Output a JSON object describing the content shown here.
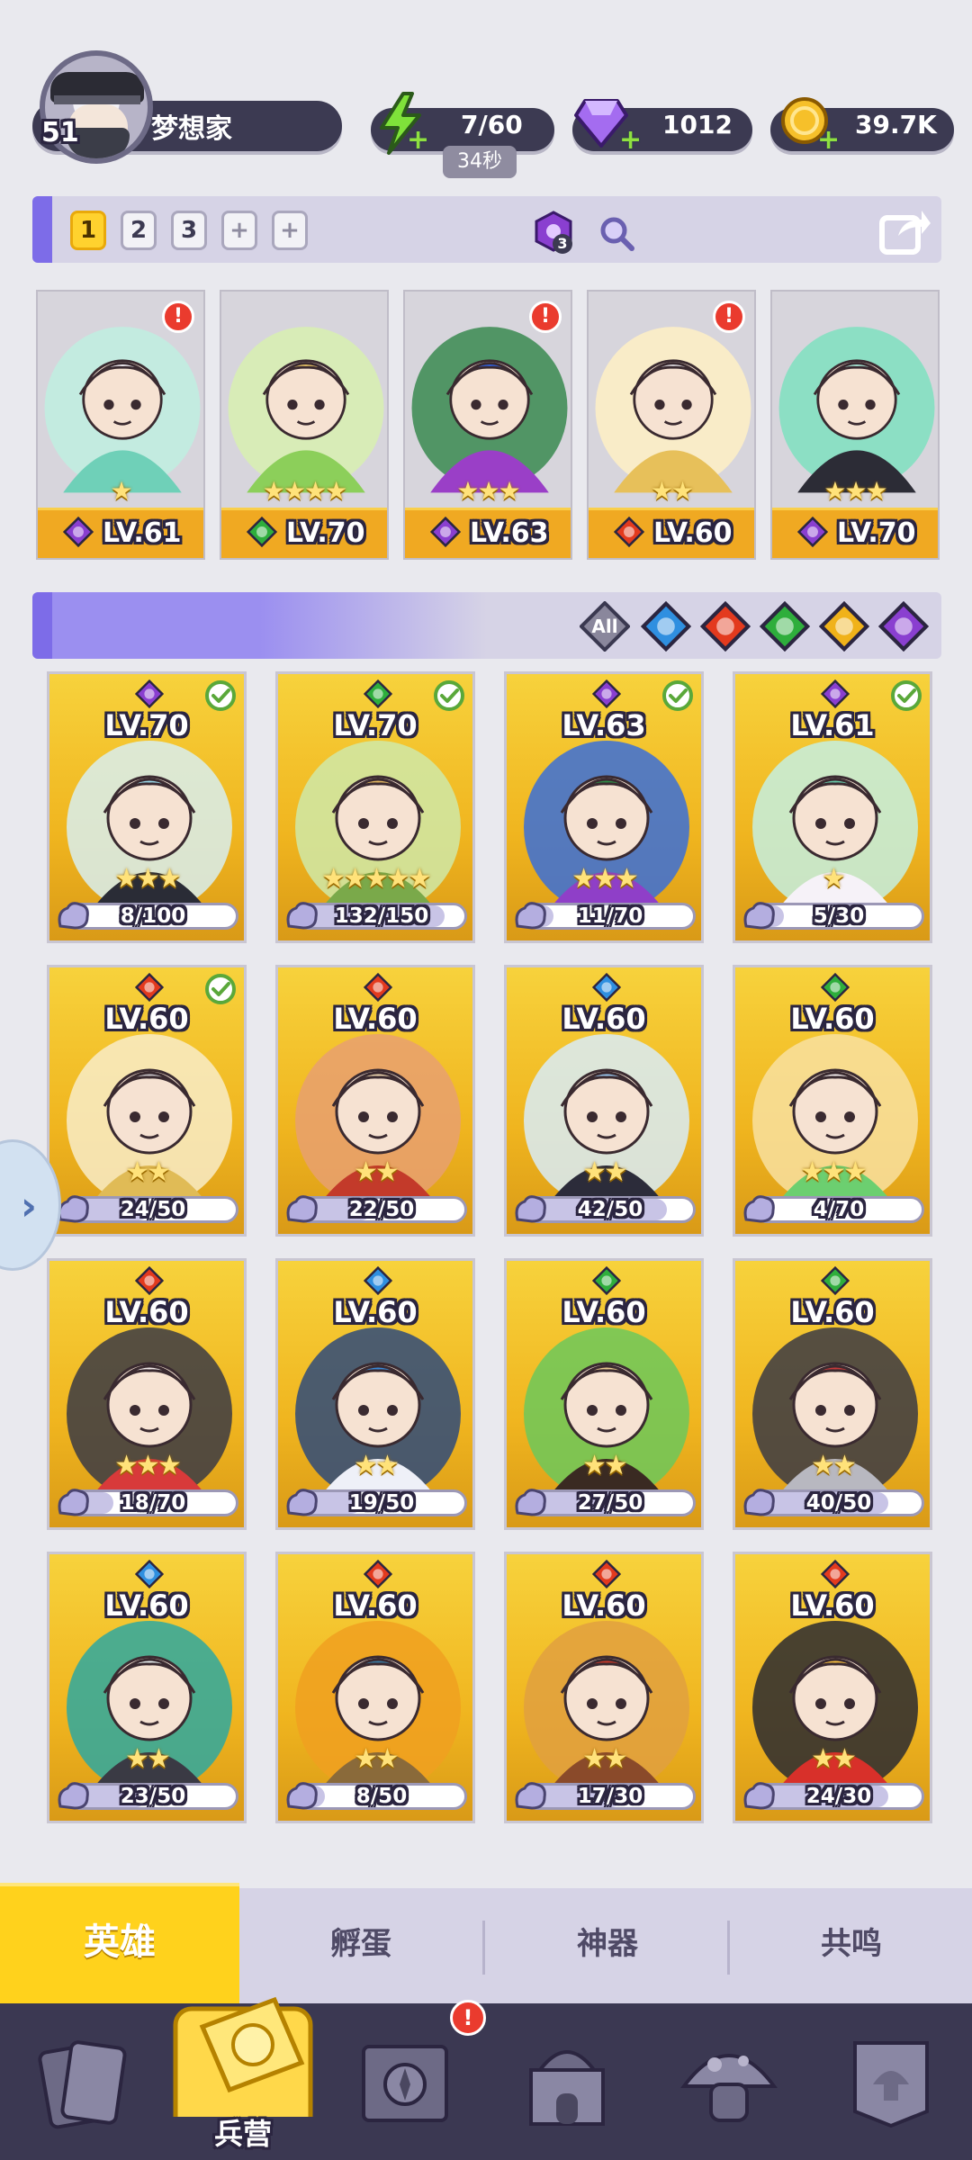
{
  "player": {
    "level": "51",
    "name": "梦想家"
  },
  "resources": {
    "energy": {
      "value": "7/60",
      "timer": "34秒",
      "icon": "lightning-icon"
    },
    "gems": {
      "value": "1012",
      "icon": "diamond-icon"
    },
    "gold": {
      "value": "39.7K",
      "icon": "coin-icon"
    }
  },
  "team_slots": [
    "1",
    "2",
    "3",
    "+",
    "+"
  ],
  "filter_badge": "3",
  "team": [
    {
      "level": "LV.61",
      "element": "dark",
      "stars": "★",
      "alert": "!",
      "palette": [
        "#bfeee0",
        "#6fd0b8",
        "#f6f2f8"
      ]
    },
    {
      "level": "LV.70",
      "element": "nature",
      "stars": "★★★★",
      "alert": "",
      "palette": [
        "#d8f0b0",
        "#8ccf5a",
        "#e4c064"
      ]
    },
    {
      "level": "LV.63",
      "element": "dark",
      "stars": "★★★",
      "alert": "!",
      "palette": [
        "#3a8a50",
        "#9a3fc7",
        "#2f5ed8"
      ]
    },
    {
      "level": "LV.60",
      "element": "fire",
      "stars": "★★",
      "alert": "!",
      "palette": [
        "#fff0c4",
        "#e7c05a",
        "#d9d5da"
      ]
    },
    {
      "level": "LV.70",
      "element": "dark",
      "stars": "★★★",
      "alert": "",
      "palette": [
        "#7fe0c0",
        "#2c2c36",
        "#a8e8d6"
      ]
    }
  ],
  "element_filters": {
    "all_label": "All",
    "items": [
      "water",
      "fire",
      "nature",
      "light",
      "dark"
    ]
  },
  "element_colors": {
    "water": "#2f8fe0",
    "fire": "#e33a1e",
    "nature": "#2eae3c",
    "light": "#f0b21a",
    "dark": "#8a3fd0"
  },
  "heroes": [
    {
      "level": "LV.70",
      "element": "dark",
      "stars": "★★★",
      "fragments": "8/100",
      "progress": 0.08,
      "owned": true,
      "palette": [
        "#d8eef0",
        "#2a2c36",
        "#9ad8e8"
      ]
    },
    {
      "level": "LV.70",
      "element": "nature",
      "stars": "★★★★★",
      "fragments": "132/150",
      "progress": 0.88,
      "owned": true,
      "palette": [
        "#cfe9a8",
        "#7aa94a",
        "#e0b660"
      ]
    },
    {
      "level": "LV.63",
      "element": "dark",
      "stars": "★★★",
      "fragments": "11/70",
      "progress": 0.16,
      "owned": true,
      "palette": [
        "#3a6fd8",
        "#8f3fc8",
        "#2e8a46"
      ]
    },
    {
      "level": "LV.61",
      "element": "dark",
      "stars": "★",
      "fragments": "5/30",
      "progress": 0.17,
      "owned": true,
      "palette": [
        "#c4f0e2",
        "#f6f2f8",
        "#68c8a8"
      ]
    },
    {
      "level": "LV.60",
      "element": "fire",
      "stars": "★★",
      "fragments": "24/50",
      "progress": 0.48,
      "owned": true,
      "palette": [
        "#f8ecc8",
        "#e0bb56",
        "#c8c4c8"
      ]
    },
    {
      "level": "LV.60",
      "element": "fire",
      "stars": "★★",
      "fragments": "22/50",
      "progress": 0.44,
      "owned": false,
      "palette": [
        "#e8a070",
        "#c33a2a",
        "#f0d8b0"
      ]
    },
    {
      "level": "LV.60",
      "element": "water",
      "stars": "★★",
      "fragments": "42/50",
      "progress": 0.84,
      "owned": false,
      "palette": [
        "#d8ecf8",
        "#2c2c3a",
        "#9ac8f0"
      ]
    },
    {
      "level": "LV.60",
      "element": "nature",
      "stars": "★★★",
      "fragments": "4/70",
      "progress": 0.06,
      "owned": false,
      "palette": [
        "#f8e0a0",
        "#6ccf70",
        "#f6f0f0"
      ]
    },
    {
      "level": "LV.60",
      "element": "fire",
      "stars": "★★★",
      "fragments": "18/70",
      "progress": 0.26,
      "owned": false,
      "palette": [
        "#3a3a44",
        "#d83a3a",
        "#f0e8e8"
      ]
    },
    {
      "level": "LV.60",
      "element": "water",
      "stars": "★★",
      "fragments": "19/50",
      "progress": 0.38,
      "owned": false,
      "palette": [
        "#2e4a7a",
        "#eef0f8",
        "#3a8ad8"
      ]
    },
    {
      "level": "LV.60",
      "element": "nature",
      "stars": "★★",
      "fragments": "27/50",
      "progress": 0.54,
      "owned": false,
      "palette": [
        "#6cc85a",
        "#3a2a22",
        "#e8c890"
      ]
    },
    {
      "level": "LV.60",
      "element": "nature",
      "stars": "★★",
      "fragments": "40/50",
      "progress": 0.8,
      "owned": false,
      "palette": [
        "#3a3a44",
        "#b8b8c0",
        "#c83a3a"
      ]
    },
    {
      "level": "LV.60",
      "element": "water",
      "stars": "★★",
      "fragments": "23/50",
      "progress": 0.46,
      "owned": false,
      "palette": [
        "#2ea8a0",
        "#3a3a44",
        "#e8f0f0"
      ]
    },
    {
      "level": "LV.60",
      "element": "fire",
      "stars": "★★",
      "fragments": "8/50",
      "progress": 0.16,
      "owned": false,
      "palette": [
        "#f0a020",
        "#8a6a3a",
        "#3a7aa0"
      ]
    },
    {
      "level": "LV.60",
      "element": "fire",
      "stars": "★★",
      "fragments": "17/30",
      "progress": 0.57,
      "owned": false,
      "palette": [
        "#e0a040",
        "#8a4a2a",
        "#c83a2a"
      ]
    },
    {
      "level": "LV.60",
      "element": "fire",
      "stars": "★★",
      "fragments": "24/30",
      "progress": 0.8,
      "owned": false,
      "palette": [
        "#2a2a30",
        "#d8302a",
        "#f8c040"
      ]
    }
  ],
  "sub_tabs": [
    "英雄",
    "孵蛋",
    "神器",
    "共鸣"
  ],
  "bottom_nav": [
    {
      "label": "",
      "icon": "cards-icon",
      "alert": ""
    },
    {
      "label": "兵营",
      "icon": "barracks-icon",
      "alert": ""
    },
    {
      "label": "",
      "icon": "map-icon",
      "alert": "!"
    },
    {
      "label": "",
      "icon": "castle-icon",
      "alert": ""
    },
    {
      "label": "",
      "icon": "mushroom-icon",
      "alert": ""
    },
    {
      "label": "",
      "icon": "guild-banner-icon",
      "alert": ""
    }
  ]
}
